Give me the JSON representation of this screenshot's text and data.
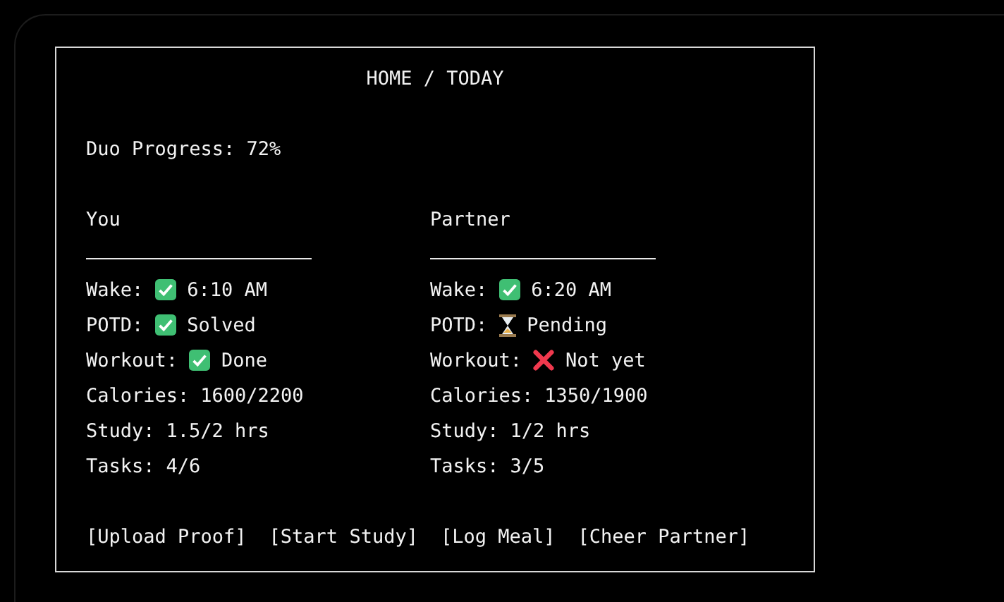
{
  "title": "HOME / TODAY",
  "progress": "Duo Progress: 72%",
  "columns": [
    {
      "name": "You",
      "rows": [
        {
          "kind": "done",
          "label": "Wake:",
          "value": "6:10 AM"
        },
        {
          "kind": "done",
          "label": "POTD:",
          "value": "Solved"
        },
        {
          "kind": "done",
          "label": "Workout:",
          "value": "Done"
        },
        {
          "kind": "plain",
          "label": "Calories:",
          "value": "1600/2200"
        },
        {
          "kind": "plain",
          "label": "Study:",
          "value": "1.5/2 hrs"
        },
        {
          "kind": "plain",
          "label": "Tasks:",
          "value": "4/6"
        }
      ]
    },
    {
      "name": "Partner",
      "rows": [
        {
          "kind": "done",
          "label": "Wake:",
          "value": "6:20 AM"
        },
        {
          "kind": "pending",
          "label": "POTD:",
          "value": "Pending"
        },
        {
          "kind": "missed",
          "label": "Workout:",
          "value": "Not yet"
        },
        {
          "kind": "plain",
          "label": "Calories:",
          "value": "1350/1900"
        },
        {
          "kind": "plain",
          "label": "Study:",
          "value": "1/2 hrs"
        },
        {
          "kind": "plain",
          "label": "Tasks:",
          "value": "3/5"
        }
      ]
    }
  ],
  "buttons": [
    "[Upload Proof]",
    "[Start Study]",
    "[Log Meal]",
    "[Cheer Partner]"
  ]
}
